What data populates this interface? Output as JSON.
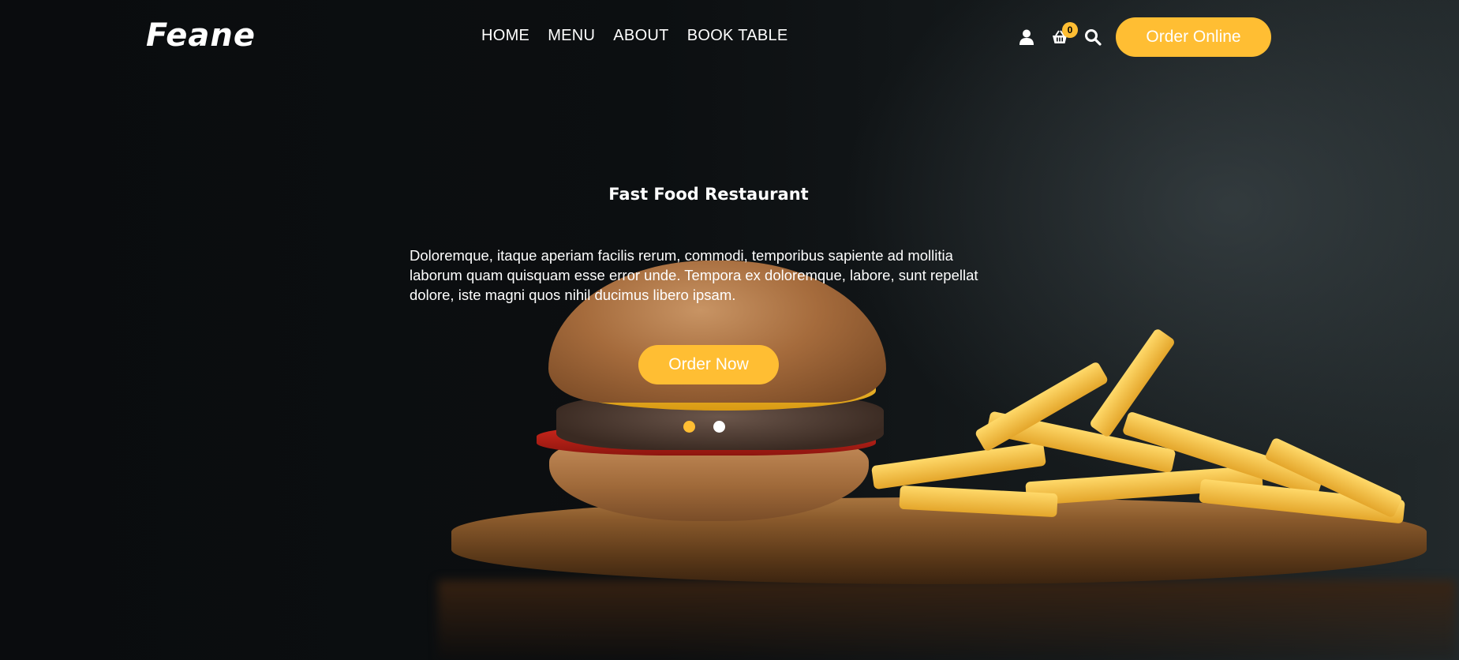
{
  "brand": {
    "name": "Feane"
  },
  "nav": {
    "items": [
      {
        "label": "HOME"
      },
      {
        "label": "MENU"
      },
      {
        "label": "ABOUT"
      },
      {
        "label": "BOOK TABLE"
      }
    ]
  },
  "header_icons": {
    "user_icon": "user-icon",
    "cart_icon": "shopping-basket-icon",
    "cart_count": "0",
    "search_icon": "search-icon"
  },
  "header": {
    "order_online_label": "Order Online"
  },
  "hero": {
    "title": "Fast Food Restaurant",
    "description": "Doloremque, itaque aperiam facilis rerum, commodi, temporibus sapiente ad mollitia laborum quam quisquam esse error unde. Tempora ex doloremque, labore, sunt repellat dolore, iste magni quos nihil ducimus libero ipsam.",
    "cta_label": "Order Now",
    "carousel": {
      "slides": 2,
      "active_index": 0
    }
  },
  "colors": {
    "accent": "#ffbe33",
    "background": "#0b0d0f",
    "text": "#ffffff"
  }
}
